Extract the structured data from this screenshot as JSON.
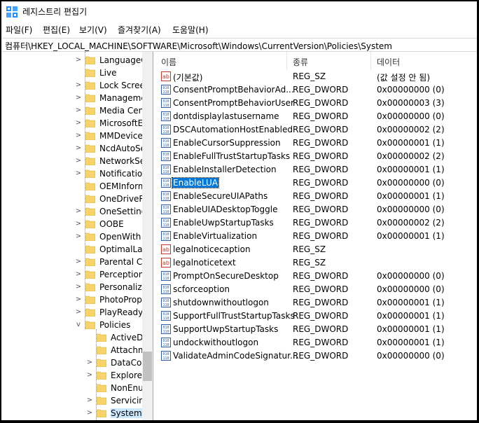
{
  "window": {
    "title": "레지스트리 편집기",
    "accent": "#0078d7"
  },
  "menu": [
    "파일(F)",
    "편집(E)",
    "보기(V)",
    "즐겨찾기(A)",
    "도움말(H)"
  ],
  "address": "컴퓨터\\HKEY_LOCAL_MACHINE\\SOFTWARE\\Microsoft\\Windows\\CurrentVersion\\Policies\\System",
  "tree": [
    {
      "label": "LanguageC",
      "expander": ">",
      "level": 1
    },
    {
      "label": "Live",
      "expander": "",
      "level": 1
    },
    {
      "label": "Lock Scree",
      "expander": ">",
      "level": 1
    },
    {
      "label": "Manageme",
      "expander": ">",
      "level": 1
    },
    {
      "label": "Media Cent",
      "expander": ">",
      "level": 1
    },
    {
      "label": "MicrosoftE",
      "expander": ">",
      "level": 1
    },
    {
      "label": "MMDevice",
      "expander": ">",
      "level": 1
    },
    {
      "label": "NcdAutoSe",
      "expander": ">",
      "level": 1
    },
    {
      "label": "NetworkSe",
      "expander": ">",
      "level": 1
    },
    {
      "label": "Notification",
      "expander": ">",
      "level": 1
    },
    {
      "label": "OEMInform",
      "expander": "",
      "level": 1
    },
    {
      "label": "OneDriveRa",
      "expander": "",
      "level": 1
    },
    {
      "label": "OneSetting",
      "expander": ">",
      "level": 1
    },
    {
      "label": "OOBE",
      "expander": ">",
      "level": 1
    },
    {
      "label": "OpenWith",
      "expander": ">",
      "level": 1
    },
    {
      "label": "OptimalLay",
      "expander": "",
      "level": 1
    },
    {
      "label": "Parental Co",
      "expander": ">",
      "level": 1
    },
    {
      "label": "Perceptions",
      "expander": ">",
      "level": 1
    },
    {
      "label": "Personaliza",
      "expander": ">",
      "level": 1
    },
    {
      "label": "PhotoPropo",
      "expander": ">",
      "level": 1
    },
    {
      "label": "PlayReady",
      "expander": ">",
      "level": 1
    },
    {
      "label": "Policies",
      "expander": "v",
      "level": 1
    },
    {
      "label": "ActiveD",
      "expander": "",
      "level": 2
    },
    {
      "label": "Attachm",
      "expander": "",
      "level": 2
    },
    {
      "label": "DataCol",
      "expander": ">",
      "level": 2
    },
    {
      "label": "Explorer",
      "expander": ">",
      "level": 2
    },
    {
      "label": "NonEnu",
      "expander": "",
      "level": 2
    },
    {
      "label": "Servicin",
      "expander": ">",
      "level": 2
    },
    {
      "label": "System",
      "expander": ">",
      "level": 2
    }
  ],
  "columns": {
    "name": "이름",
    "type": "종류",
    "data": "데이터"
  },
  "values": [
    {
      "name": "(기본값)",
      "type": "REG_SZ",
      "data": "(값 설정 안 됨)",
      "icon": "string"
    },
    {
      "name": "ConsentPromptBehaviorAd...",
      "type": "REG_DWORD",
      "data": "0x00000000 (0)",
      "icon": "dword"
    },
    {
      "name": "ConsentPromptBehaviorUser",
      "type": "REG_DWORD",
      "data": "0x00000003 (3)",
      "icon": "dword"
    },
    {
      "name": "dontdisplaylastusername",
      "type": "REG_DWORD",
      "data": "0x00000000 (0)",
      "icon": "dword"
    },
    {
      "name": "DSCAutomationHostEnabled",
      "type": "REG_DWORD",
      "data": "0x00000002 (2)",
      "icon": "dword"
    },
    {
      "name": "EnableCursorSuppression",
      "type": "REG_DWORD",
      "data": "0x00000001 (1)",
      "icon": "dword"
    },
    {
      "name": "EnableFullTrustStartupTasks",
      "type": "REG_DWORD",
      "data": "0x00000002 (2)",
      "icon": "dword"
    },
    {
      "name": "EnableInstallerDetection",
      "type": "REG_DWORD",
      "data": "0x00000001 (1)",
      "icon": "dword"
    },
    {
      "name": "EnableLUA",
      "type": "REG_DWORD",
      "data": "0x00000000 (0)",
      "icon": "dword",
      "selected": true
    },
    {
      "name": "EnableSecureUIAPaths",
      "type": "REG_DWORD",
      "data": "0x00000001 (1)",
      "icon": "dword"
    },
    {
      "name": "EnableUIADesktopToggle",
      "type": "REG_DWORD",
      "data": "0x00000000 (0)",
      "icon": "dword"
    },
    {
      "name": "EnableUwpStartupTasks",
      "type": "REG_DWORD",
      "data": "0x00000002 (2)",
      "icon": "dword"
    },
    {
      "name": "EnableVirtualization",
      "type": "REG_DWORD",
      "data": "0x00000001 (1)",
      "icon": "dword"
    },
    {
      "name": "legalnoticecaption",
      "type": "REG_SZ",
      "data": "",
      "icon": "string"
    },
    {
      "name": "legalnoticetext",
      "type": "REG_SZ",
      "data": "",
      "icon": "string"
    },
    {
      "name": "PromptOnSecureDesktop",
      "type": "REG_DWORD",
      "data": "0x00000000 (0)",
      "icon": "dword"
    },
    {
      "name": "scforceoption",
      "type": "REG_DWORD",
      "data": "0x00000000 (0)",
      "icon": "dword"
    },
    {
      "name": "shutdownwithoutlogon",
      "type": "REG_DWORD",
      "data": "0x00000001 (1)",
      "icon": "dword"
    },
    {
      "name": "SupportFullTrustStartupTasks",
      "type": "REG_DWORD",
      "data": "0x00000001 (1)",
      "icon": "dword"
    },
    {
      "name": "SupportUwpStartupTasks",
      "type": "REG_DWORD",
      "data": "0x00000001 (1)",
      "icon": "dword"
    },
    {
      "name": "undockwithoutlogon",
      "type": "REG_DWORD",
      "data": "0x00000001 (1)",
      "icon": "dword"
    },
    {
      "name": "ValidateAdminCodeSignatur...",
      "type": "REG_DWORD",
      "data": "0x00000000 (0)",
      "icon": "dword"
    }
  ]
}
